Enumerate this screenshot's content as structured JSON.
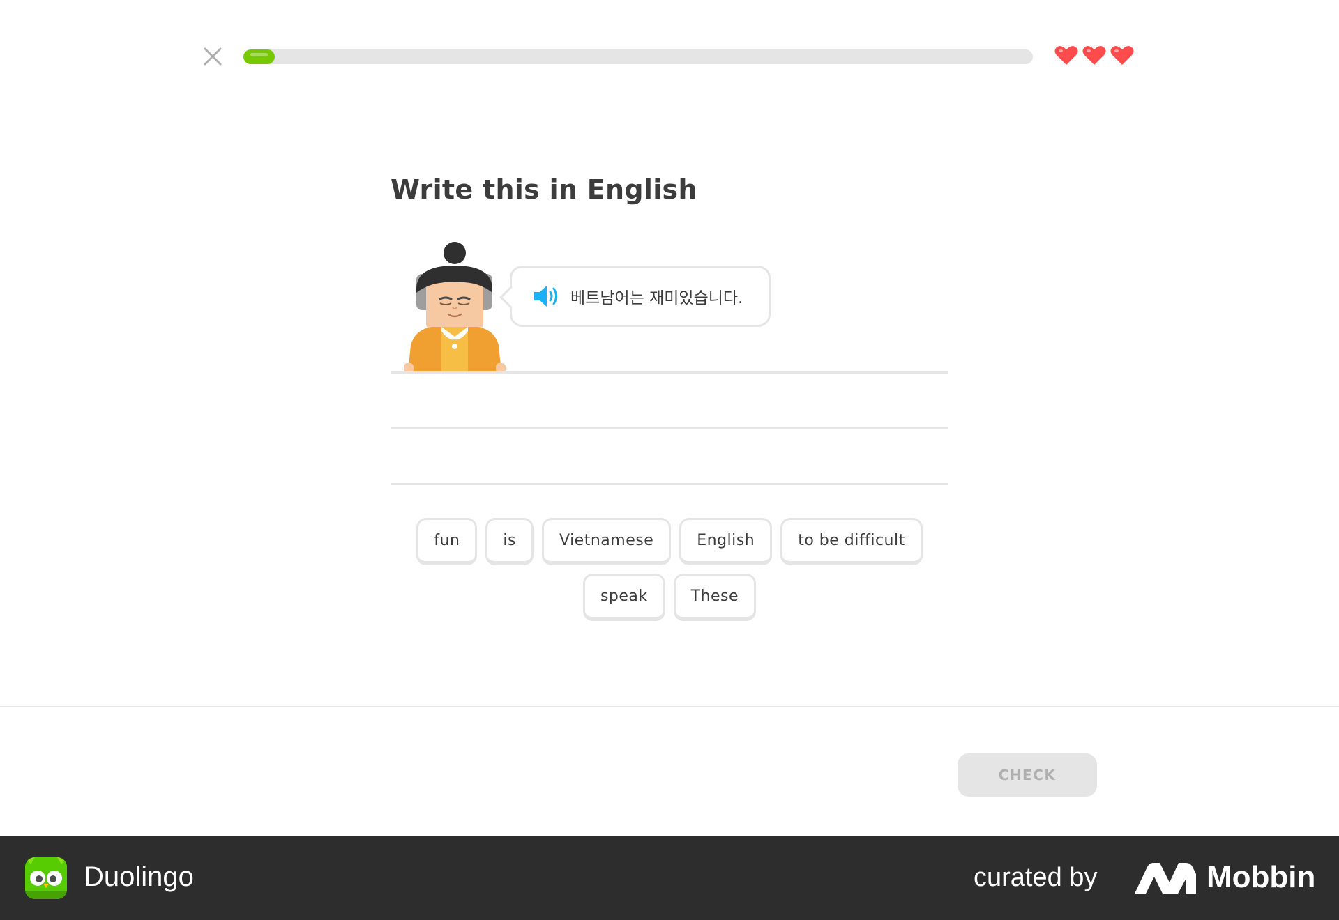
{
  "header": {
    "close_icon": "close-icon",
    "progress": 0.04,
    "progress_color": "#78c800",
    "hearts": 3,
    "heart_color": "#ff4b4b"
  },
  "prompt": {
    "title": "Write this in English",
    "speaker_icon": "speaker-icon",
    "sentence": "베트남어는 재미있습니다."
  },
  "word_bank": {
    "tiles": [
      "fun",
      "is",
      "Vietnamese",
      "English",
      "to be difficult",
      "speak",
      "These"
    ]
  },
  "footer": {
    "check_label": "CHECK"
  },
  "credit": {
    "app_name": "Duolingo",
    "curated_by": "curated by",
    "brand": "Mobbin"
  }
}
